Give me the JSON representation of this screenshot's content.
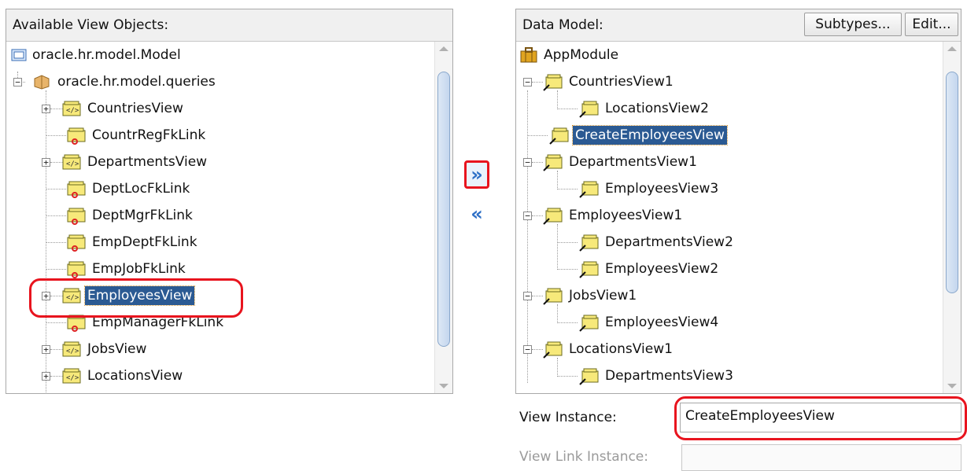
{
  "left_panel": {
    "title": "Available View Objects:",
    "items": [
      {
        "label": "oracle.hr.model.Model"
      },
      {
        "label": "oracle.hr.model.queries"
      },
      {
        "label": "CountriesView"
      },
      {
        "label": "CountrRegFkLink"
      },
      {
        "label": "DepartmentsView"
      },
      {
        "label": "DeptLocFkLink"
      },
      {
        "label": "DeptMgrFkLink"
      },
      {
        "label": "EmpDeptFkLink"
      },
      {
        "label": "EmpJobFkLink"
      },
      {
        "label": "EmployeesView"
      },
      {
        "label": "EmpManagerFkLink"
      },
      {
        "label": "JobsView"
      },
      {
        "label": "LocationsView"
      }
    ]
  },
  "shuttle": {
    "add_symbol": "»",
    "remove_symbol": "«"
  },
  "right_panel": {
    "title": "Data Model:",
    "subtypes_label": "Subtypes...",
    "edit_label": "Edit...",
    "items": [
      {
        "label": "AppModule"
      },
      {
        "label": "CountriesView1"
      },
      {
        "label": "LocationsView2"
      },
      {
        "label": "CreateEmployeesView"
      },
      {
        "label": "DepartmentsView1"
      },
      {
        "label": "EmployeesView3"
      },
      {
        "label": "EmployeesView1"
      },
      {
        "label": "DepartmentsView2"
      },
      {
        "label": "EmployeesView2"
      },
      {
        "label": "JobsView1"
      },
      {
        "label": "EmployeesView4"
      },
      {
        "label": "LocationsView1"
      },
      {
        "label": "DepartmentsView3"
      }
    ]
  },
  "form": {
    "view_instance_label": "View Instance:",
    "view_instance_value": "CreateEmployeesView",
    "view_link_instance_label": "View Link Instance:",
    "view_link_instance_value": ""
  },
  "colors": {
    "selection": "#2b5a93",
    "highlight_ring": "#e8141e",
    "shuttle_arrow": "#2d6fc6"
  },
  "icons": {
    "package": "folder-icon",
    "queries": "package-icon",
    "view_object": "view-object-icon",
    "view_link": "view-link-icon",
    "app_module": "briefcase-icon"
  }
}
